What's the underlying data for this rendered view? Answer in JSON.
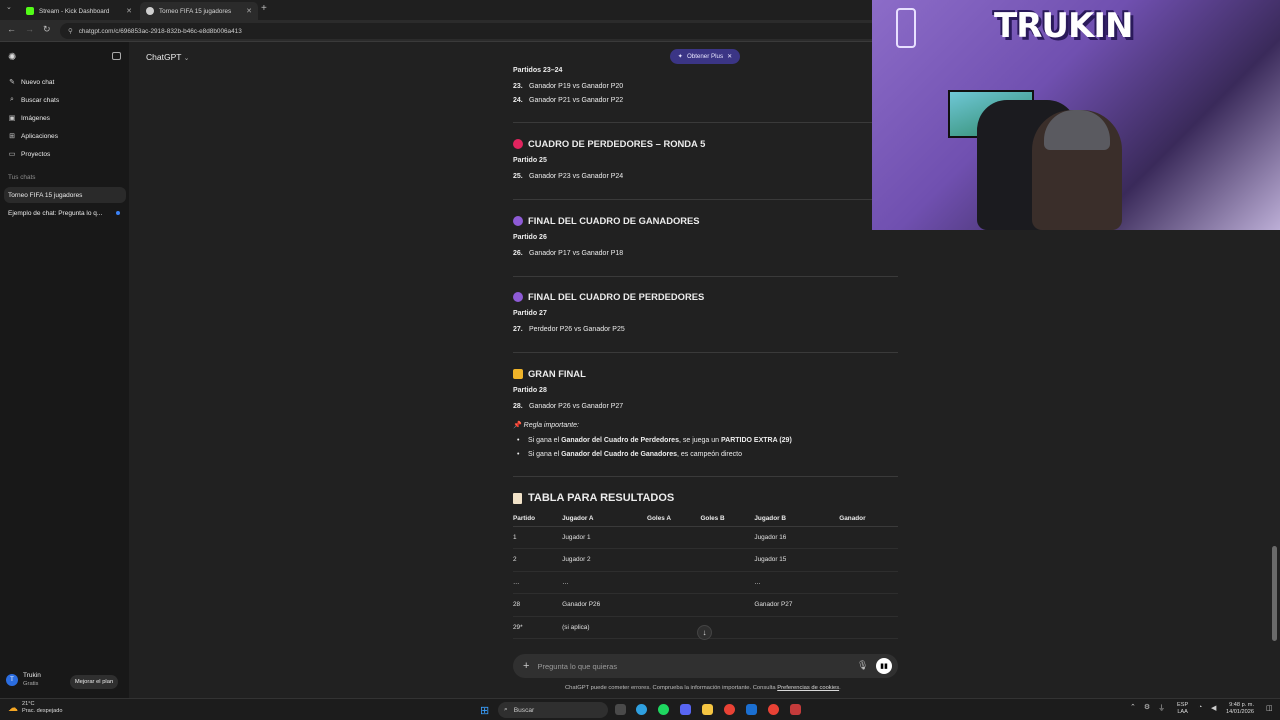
{
  "browser": {
    "tabs": [
      {
        "label": "Stream - Kick Dashboard",
        "favicon_color": "#53fc18"
      },
      {
        "label": "Torneo FIFA 15 jugadores",
        "favicon_color": "#cfcfcf"
      }
    ],
    "url": "chatgpt.com/c/696853ac-2918-832b-b46c-e8d8b006a413"
  },
  "sidebar": {
    "items": [
      {
        "label": "Nuevo chat",
        "icon": "edit-icon"
      },
      {
        "label": "Buscar chats",
        "icon": "search-icon"
      },
      {
        "label": "Imágenes",
        "icon": "image-icon"
      },
      {
        "label": "Aplicaciones",
        "icon": "apps-icon"
      },
      {
        "label": "Proyectos",
        "icon": "folder-icon"
      }
    ],
    "section_label": "Tus chats",
    "chats": [
      "Torneo FIFA 15 jugadores",
      "Ejemplo de chat: Pregunta lo q..."
    ],
    "user": {
      "initial": "T",
      "name": "Trukin",
      "plan": "Gratis"
    },
    "upgrade_label": "Mejorar el plan"
  },
  "header": {
    "title": "ChatGPT",
    "plus_label": "Obtener Plus"
  },
  "content": {
    "partidos_23_24": "Partidos 23–24",
    "m23": {
      "num": "23.",
      "text": "Ganador P19 vs Ganador P20"
    },
    "m24": {
      "num": "24.",
      "text": "Ganador P21 vs Ganador P22"
    },
    "s1": {
      "title": "CUADRO DE PERDEDORES – RONDA 5",
      "sub": "Partido 25",
      "num": "25.",
      "text": "Ganador P23 vs Ganador P24",
      "color": "#e0245e"
    },
    "s2": {
      "title": "FINAL DEL CUADRO DE GANADORES",
      "sub": "Partido 26",
      "num": "26.",
      "text": "Ganador P17 vs Ganador P18",
      "color": "#8e5bd6"
    },
    "s3": {
      "title": "FINAL DEL CUADRO DE PERDEDORES",
      "sub": "Partido 27",
      "num": "27.",
      "text": "Perdedor P26 vs Ganador P25",
      "color": "#8e5bd6"
    },
    "s4": {
      "title": "GRAN FINAL",
      "sub": "Partido 28",
      "num": "28.",
      "text": "Ganador P26 vs Ganador P27",
      "color": "#f0b429"
    },
    "rule_label": "Regla importante:",
    "rule1": {
      "pre": "Si gana el ",
      "b1": "Ganador del Cuadro de Perdedores",
      "mid": ", se juega un ",
      "b2": "PARTIDO EXTRA (29)"
    },
    "rule2": {
      "pre": "Si gana el ",
      "b1": "Ganador del Cuadro de Ganadores",
      "post": ", es campeón directo"
    },
    "table_title": "TABLA PARA RESULTADOS",
    "table": {
      "headers": [
        "Partido",
        "Jugador A",
        "Goles A",
        "Goles B",
        "Jugador B",
        "Ganador"
      ],
      "rows": [
        [
          "1",
          "Jugador 1",
          "",
          "",
          "Jugador 16",
          ""
        ],
        [
          "2",
          "Jugador 2",
          "",
          "",
          "Jugador 15",
          ""
        ],
        [
          "…",
          "…",
          "",
          "",
          "…",
          ""
        ],
        [
          "28",
          "Ganador P26",
          "",
          "",
          "Ganador P27",
          ""
        ],
        [
          "29*",
          "(si aplica)",
          "",
          "",
          "",
          ""
        ]
      ]
    }
  },
  "composer": {
    "placeholder": "Pregunta lo que quieras"
  },
  "disclaimer": {
    "text": "ChatGPT puede cometer errores. Comprueba la información importante. Consulta ",
    "link": "Preferencias de cookies",
    "end": "."
  },
  "webcam": {
    "logo": "TRUKIN"
  },
  "taskbar": {
    "temp": "21°C",
    "weather": "Prac. despejado",
    "search": "Buscar",
    "lang1": "ESP",
    "lang2": "LAA",
    "time": "9:48 p. m.",
    "date": "14/01/2026"
  }
}
